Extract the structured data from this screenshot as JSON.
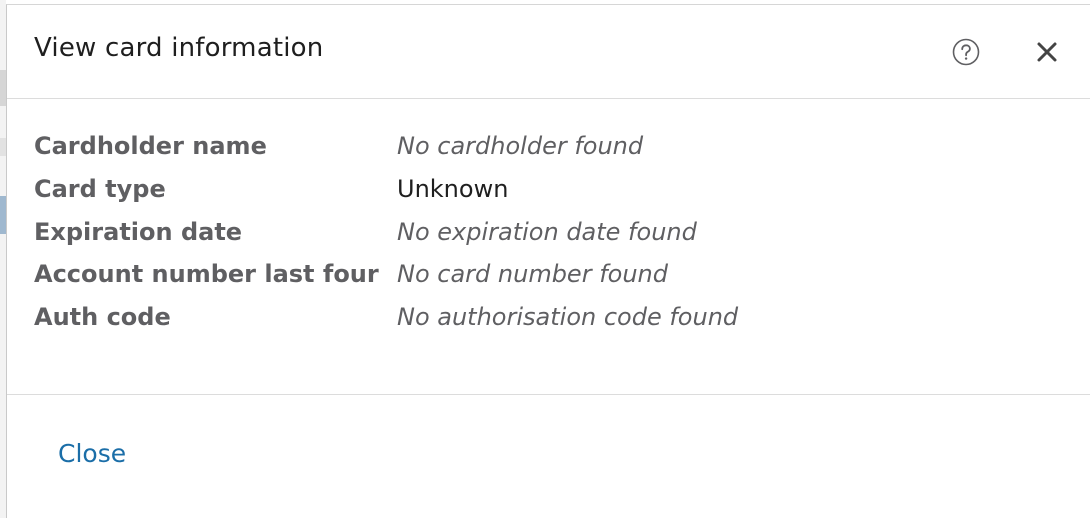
{
  "modal": {
    "title": "View card information",
    "help_icon": "help-circle-icon",
    "close_icon": "close-icon"
  },
  "card_info": {
    "rows": [
      {
        "label": "Cardholder name",
        "value": "No cardholder found",
        "found": false
      },
      {
        "label": "Card type",
        "value": "Unknown",
        "found": true
      },
      {
        "label": "Expiration date",
        "value": "No expiration date found",
        "found": false
      },
      {
        "label": "Account number last four",
        "value": "No card number found",
        "found": false
      },
      {
        "label": "Auth code",
        "value": "No authorisation code found",
        "found": false
      }
    ]
  },
  "footer": {
    "close_label": "Close"
  },
  "colors": {
    "link": "#1b6ea8",
    "label": "#5f5f62",
    "title": "#1f1f1f",
    "divider": "#dcdcdc"
  }
}
